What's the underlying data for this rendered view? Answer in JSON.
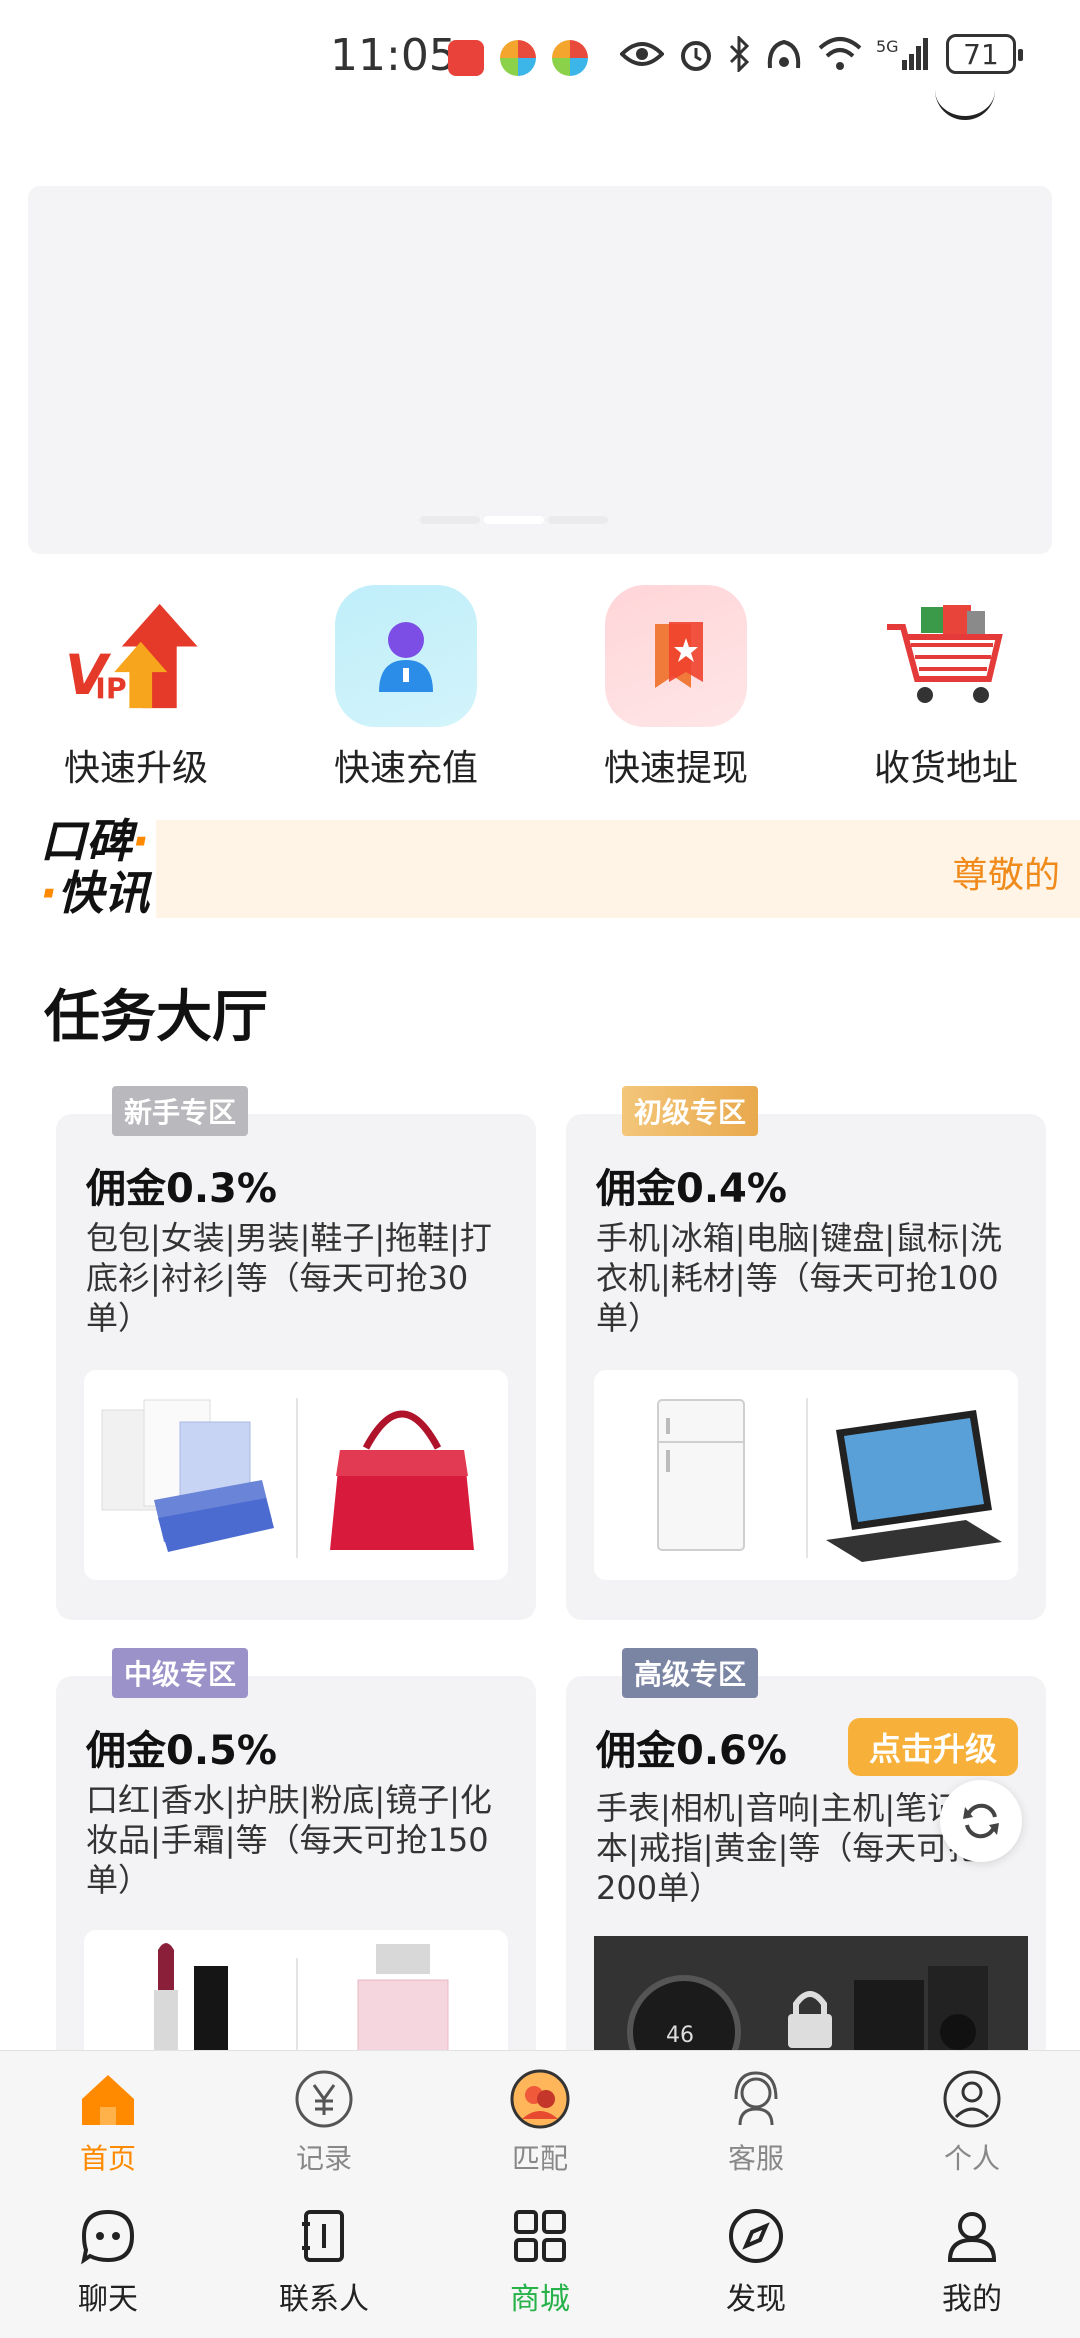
{
  "status_bar": {
    "time": "11:05",
    "battery": "71"
  },
  "quick_actions": [
    {
      "label": "快速升级",
      "icon": "vip-upgrade-icon"
    },
    {
      "label": "快速充值",
      "icon": "recharge-person-icon"
    },
    {
      "label": "快速提现",
      "icon": "withdraw-bookmark-icon"
    },
    {
      "label": "收货地址",
      "icon": "shopping-cart-icon"
    }
  ],
  "news": {
    "logo_line1": "口碑",
    "logo_line2": "快讯",
    "ticker": "尊敬的"
  },
  "task_hall": {
    "title": "任务大厅",
    "cards": [
      {
        "tag": "新手专区",
        "commission": "佣金0.3%",
        "desc": "包包|女装|男装|鞋子|拖鞋|打底衫|衬衫|等（每天可抢30单）"
      },
      {
        "tag": "初级专区",
        "commission": "佣金0.4%",
        "desc": "手机|冰箱|电脑|键盘|鼠标|洗衣机|耗材|等（每天可抢100单）"
      },
      {
        "tag": "中级专区",
        "commission": "佣金0.5%",
        "desc": "口红|香水|护肤|粉底|镜子|化妆品|手霜|等（每天可抢150单）"
      },
      {
        "tag": "高级专区",
        "commission": "佣金0.6%",
        "desc": "手表|相机|音响|主机|笔记本|戒指|黄金|等（每天可抢200单）"
      }
    ],
    "upgrade_button": "点击升级"
  },
  "bottom_nav_primary": [
    {
      "label": "首页",
      "active": true
    },
    {
      "label": "记录",
      "active": false
    },
    {
      "label": "匹配",
      "active": false
    },
    {
      "label": "客服",
      "active": false
    },
    {
      "label": "个人",
      "active": false
    }
  ],
  "bottom_nav_secondary": [
    {
      "label": "聊天",
      "active": false
    },
    {
      "label": "联系人",
      "active": false
    },
    {
      "label": "商城",
      "active": true
    },
    {
      "label": "发现",
      "active": false
    },
    {
      "label": "我的",
      "active": false
    }
  ],
  "colors": {
    "accent_orange": "#ff8a00",
    "active_green": "#27b24a"
  }
}
